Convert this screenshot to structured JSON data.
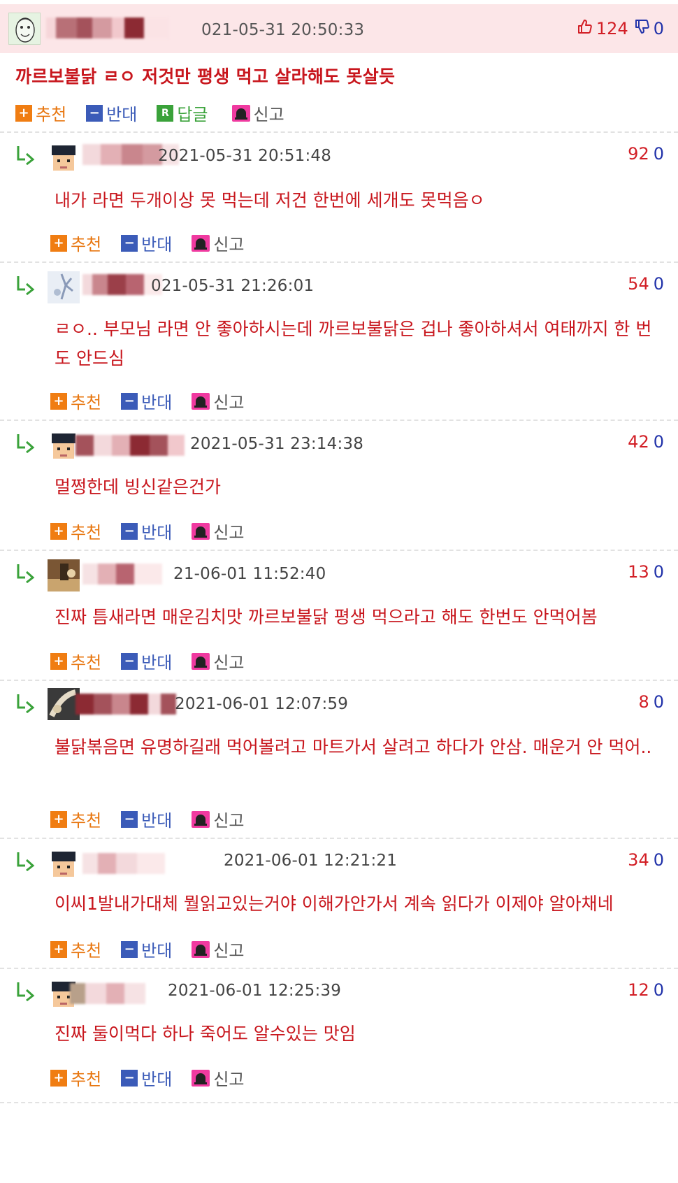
{
  "top": {
    "timestamp": "021-05-31 20:50:33",
    "up": "124",
    "down": "0",
    "text": "까르보불닭 ㄹㅇ 저것만 평생 먹고 살라해도 못살듯",
    "actions": {
      "recommend": "추천",
      "oppose": "반대",
      "reply": "답글",
      "report": "신고"
    },
    "reply_icon_letter": "R"
  },
  "replies": [
    {
      "timestamp": "2021-05-31 20:51:48",
      "up": "92",
      "down": "0",
      "text": "내가 라면 두개이상 못 먹는데 저건 한번에 세개도 못먹음ㅇ"
    },
    {
      "timestamp": "021-05-31 21:26:01",
      "up": "54",
      "down": "0",
      "text": "ㄹㅇ.. 부모님 라면 안 좋아하시는데 까르보불닭은 겁나 좋아하셔서 여태까지 한 번도 안드심"
    },
    {
      "timestamp": "2021-05-31 23:14:38",
      "up": "42",
      "down": "0",
      "text": "멀쩡한데 빙신같은건가"
    },
    {
      "timestamp": "21-06-01 11:52:40",
      "up": "13",
      "down": "0",
      "text": "진짜 틈새라면 매운김치맛 까르보불닭 평생 먹으라고 해도 한번도 안먹어봄"
    },
    {
      "timestamp": "2021-06-01 12:07:59",
      "up": "8",
      "down": "0",
      "text": "불닭볶음면 유명하길래 먹어볼려고 마트가서 살려고 하다가 안삼. 매운거 안 먹어.."
    },
    {
      "timestamp": "2021-06-01 12:21:21",
      "up": "34",
      "down": "0",
      "text": "이씨1발내가대체 뭘읽고있는거야 이해가안가서 계속 읽다가 이제야 알아채네"
    },
    {
      "timestamp": "2021-06-01 12:25:39",
      "up": "12",
      "down": "0",
      "text": "진짜 둘이먹다 하나 죽어도 알수있는 맛임"
    }
  ],
  "actions": {
    "recommend": "추천",
    "oppose": "반대",
    "report": "신고"
  },
  "colors": {
    "accent_red": "#c8161d",
    "recommend_orange": "#e87711",
    "oppose_blue": "#3b5bb8",
    "reply_green": "#3aa23a",
    "report_pink": "#f03aa0"
  }
}
